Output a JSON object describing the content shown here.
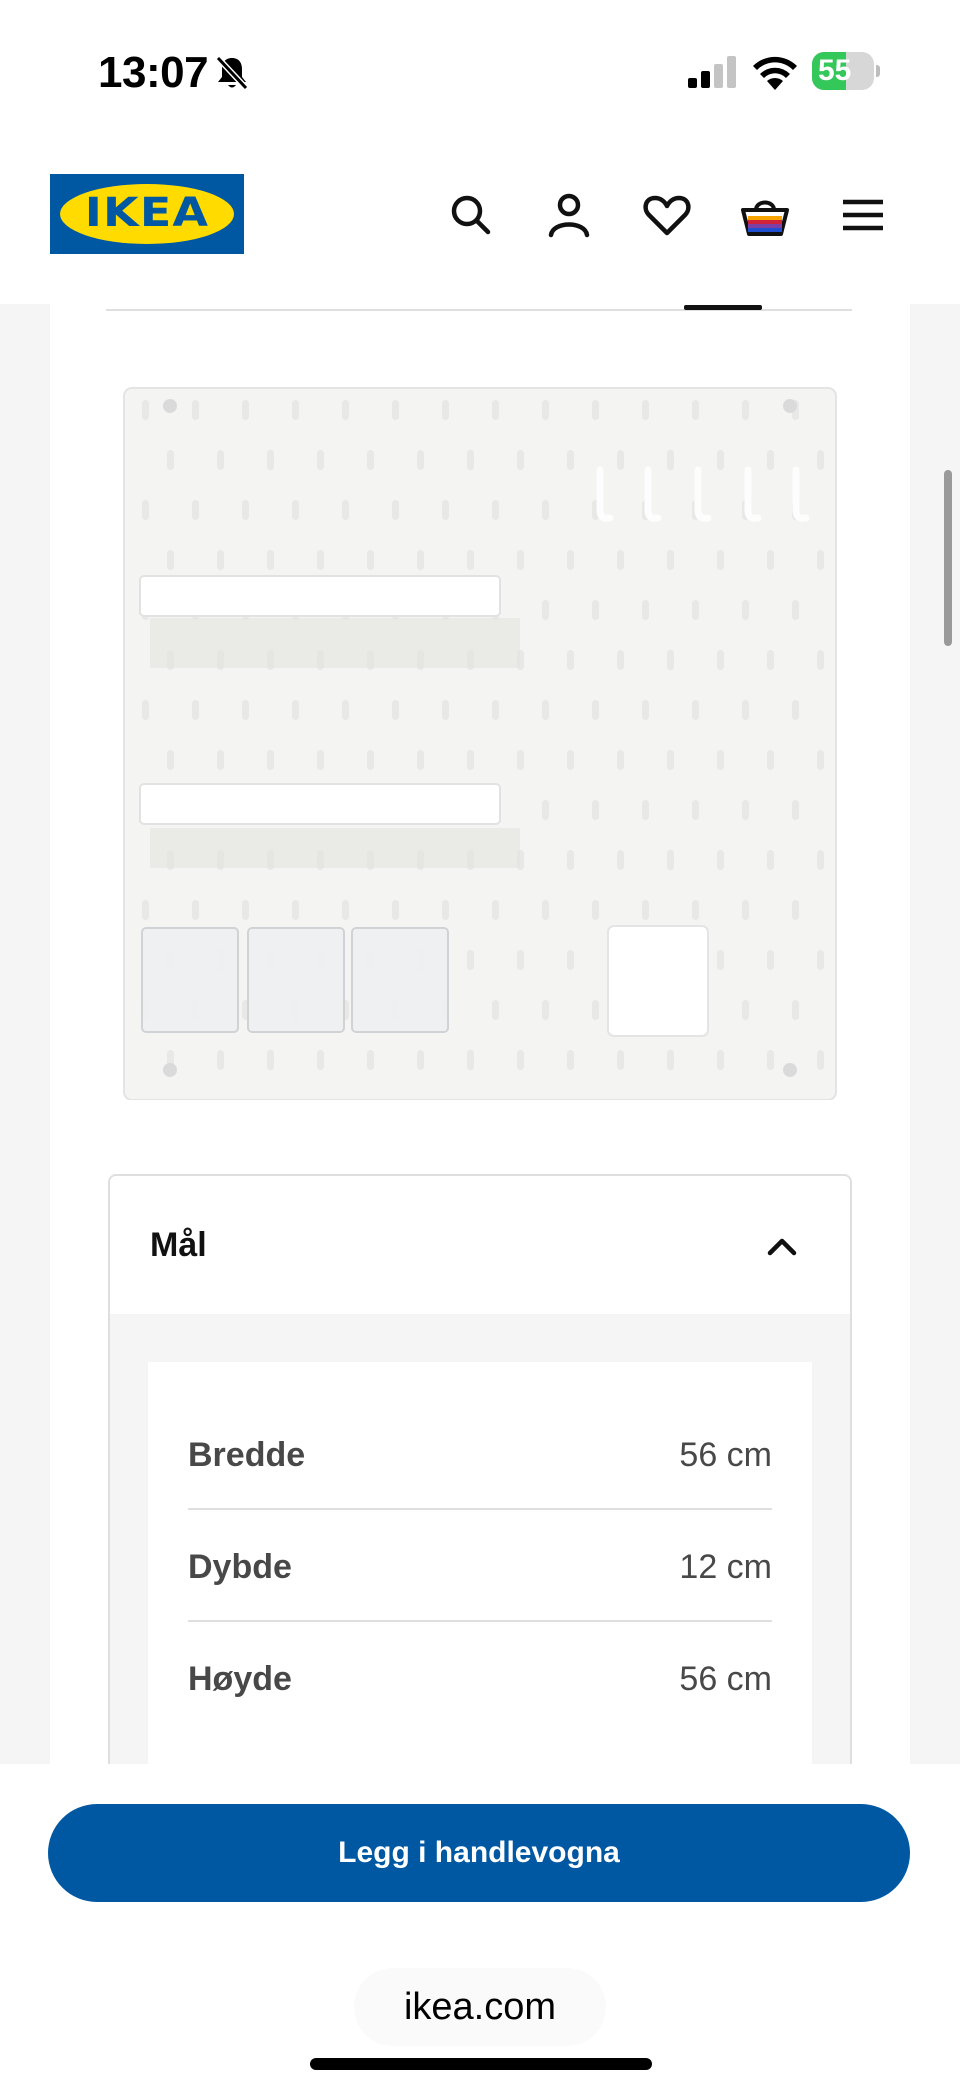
{
  "status_bar": {
    "time": "13:07",
    "battery_percent": "55",
    "battery_level": 0.55,
    "icons": [
      "bell-slash-icon",
      "signal-icon",
      "wifi-icon",
      "battery-charging-icon"
    ]
  },
  "header": {
    "logo_text": "IKEA",
    "brand_colors": {
      "blue": "#0058a3",
      "yellow": "#ffdb00"
    },
    "icons": [
      "search-icon",
      "account-icon",
      "heart-icon",
      "shopping-basket-icon",
      "menu-icon"
    ]
  },
  "product": {
    "image_alt": "Pegboard with shelves, hooks and containers"
  },
  "dimensions": {
    "title": "Mål",
    "rows": [
      {
        "label": "Bredde",
        "value": "56 cm"
      },
      {
        "label": "Dybde",
        "value": "12 cm"
      },
      {
        "label": "Høyde",
        "value": "56 cm"
      }
    ]
  },
  "actions": {
    "add_to_cart": "Legg i handlevogna",
    "button_color": "#0058a3"
  },
  "browser": {
    "url": "ikea.com"
  }
}
